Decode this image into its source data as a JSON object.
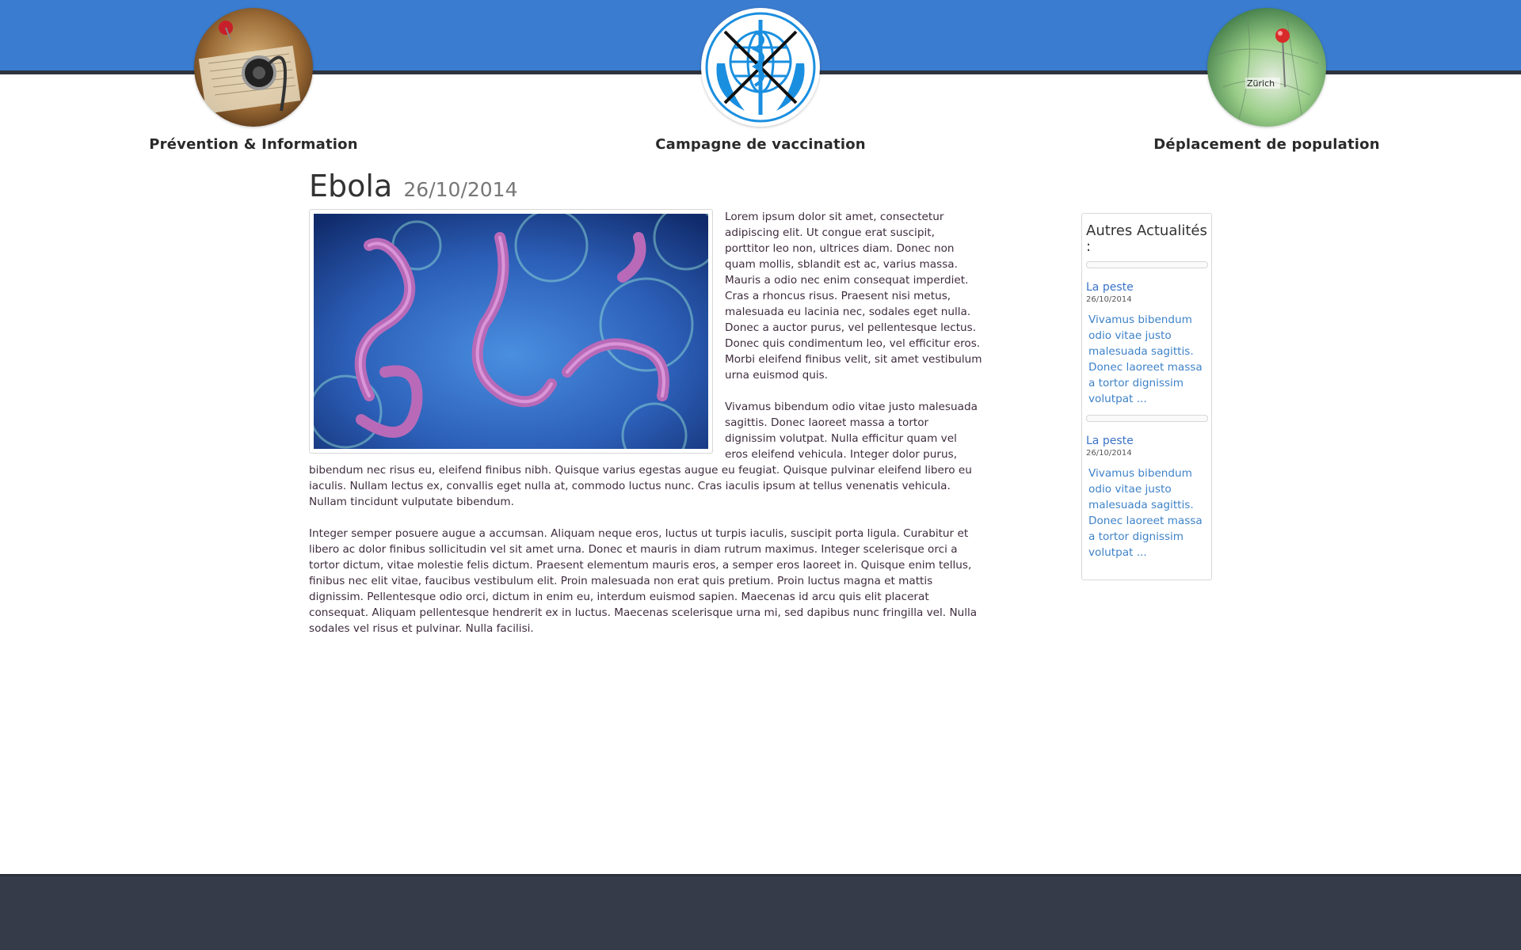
{
  "nav": {
    "items": [
      {
        "label": "Prévention & Information",
        "icon": "stethoscope-book-image"
      },
      {
        "label": "Campagne de vaccination",
        "icon": "who-emblem-image"
      },
      {
        "label": "Déplacement de population",
        "icon": "map-pin-zurich-image"
      }
    ]
  },
  "article": {
    "title": "Ebola",
    "date": "26/10/2014",
    "paragraphs": [
      "Lorem ipsum dolor sit amet, consectetur adipiscing elit. Ut congue erat suscipit, porttitor leo non, ultrices diam. Donec non quam mollis, sblandit est ac, varius massa. Mauris a odio nec enim consequat imperdiet. Cras a rhoncus risus. Praesent nisi metus, malesuada eu lacinia nec, sodales eget nulla. Donec a auctor purus, vel pellentesque lectus. Donec quis condimentum leo, vel efficitur eros. Morbi eleifend finibus velit, sit amet vestibulum urna euismod quis.",
      "Vivamus bibendum odio vitae justo malesuada sagittis. Donec laoreet massa a tortor dignissim volutpat. Nulla efficitur quam vel eros eleifend vehicula. Integer dolor purus, bibendum nec risus eu, eleifend finibus nibh. Quisque varius egestas augue eu feugiat. Quisque pulvinar eleifend libero eu iaculis. Nullam lectus ex, convallis eget nulla at, commodo luctus nunc. Cras iaculis ipsum at tellus venenatis vehicula. Nullam tincidunt vulputate bibendum.",
      "Integer semper posuere augue a accumsan. Aliquam neque eros, luctus ut turpis iaculis, suscipit porta ligula. Curabitur et libero ac dolor finibus sollicitudin vel sit amet urna. Donec et mauris in diam rutrum maximus. Integer scelerisque orci a tortor dictum, vitae molestie felis dictum. Praesent elementum mauris eros, a semper eros laoreet in. Quisque enim tellus, finibus nec elit vitae, faucibus vestibulum elit. Proin malesuada non erat quis pretium. Proin luctus magna et mattis dignissim. Pellentesque odio orci, dictum in enim eu, interdum euismod sapien. Maecenas id arcu quis elit placerat consequat. Aliquam pellentesque hendrerit ex in luctus. Maecenas scelerisque urna mi, sed dapibus nunc fringilla vel. Nulla sodales vel risus et pulvinar. Nulla facilisi."
    ],
    "image_icon": "ebola-virus-image"
  },
  "sidebar": {
    "title": "Autres Actualités :",
    "news": [
      {
        "title": "La peste",
        "date": "26/10/2014",
        "excerpt": "Vivamus bibendum odio vitae justo malesuada sagittis. Donec laoreet massa a tortor dignissim volutpat ..."
      },
      {
        "title": "La peste",
        "date": "26/10/2014",
        "excerpt": "Vivamus bibendum odio vitae justo malesuada sagittis. Donec laoreet massa a tortor dignissim volutpat ..."
      }
    ]
  },
  "colors": {
    "header_blue": "#3a7cd0",
    "footer_dark": "#363b4a",
    "link_blue": "#3a72c8",
    "body_text": "#3e2c3d"
  }
}
